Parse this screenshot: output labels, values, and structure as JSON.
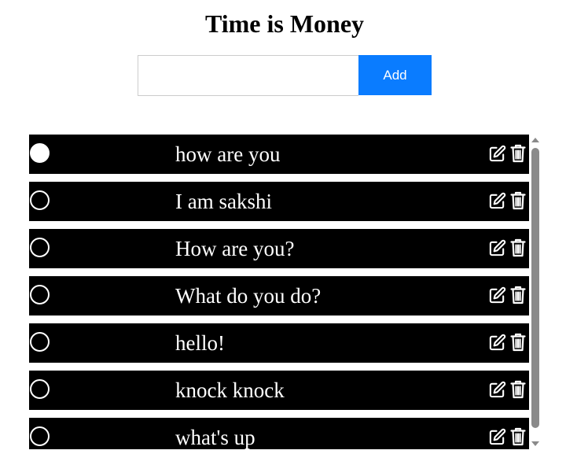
{
  "header": {
    "title": "Time is Money"
  },
  "form": {
    "input_value": "",
    "input_placeholder": "",
    "add_label": "Add"
  },
  "todos": [
    {
      "text": "how are you",
      "checked": true
    },
    {
      "text": "I am sakshi",
      "checked": false
    },
    {
      "text": "How are you?",
      "checked": false
    },
    {
      "text": "What do you do?",
      "checked": false
    },
    {
      "text": "hello!",
      "checked": false
    },
    {
      "text": "knock knock",
      "checked": false
    },
    {
      "text": "what's up",
      "checked": false
    }
  ],
  "icons": {
    "edit": "edit-icon",
    "delete": "trash-icon",
    "unchecked": "radio-empty",
    "checked": "radio-filled"
  },
  "colors": {
    "accent": "#0a7cff",
    "item_background": "#000000",
    "item_text": "#ffffff",
    "scrollbar": "#8a8a8a"
  }
}
